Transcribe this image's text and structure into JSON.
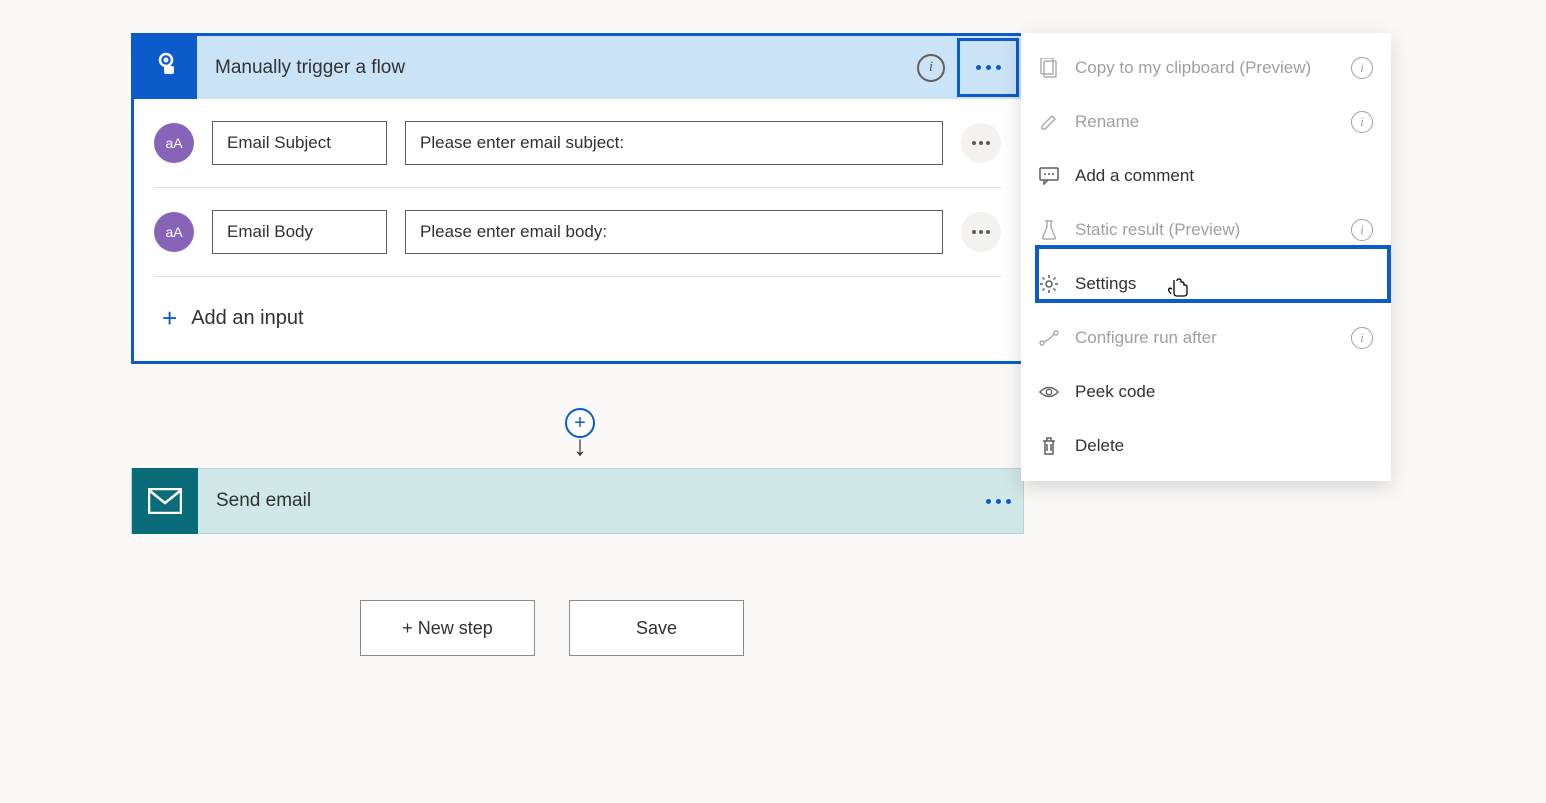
{
  "trigger": {
    "title": "Manually trigger a flow",
    "inputs": [
      {
        "name": "Email Subject",
        "placeholder": "Please enter email subject:",
        "badge": "aA"
      },
      {
        "name": "Email Body",
        "placeholder": "Please enter email body:",
        "badge": "aA"
      }
    ],
    "add_input": "Add an input"
  },
  "action": {
    "title": "Send email"
  },
  "footer": {
    "new_step": "+ New step",
    "save": "Save"
  },
  "menu": {
    "copy": "Copy to my clipboard (Preview)",
    "rename": "Rename",
    "comment": "Add a comment",
    "static_result": "Static result (Preview)",
    "settings": "Settings",
    "run_after": "Configure run after",
    "peek": "Peek code",
    "delete": "Delete"
  }
}
